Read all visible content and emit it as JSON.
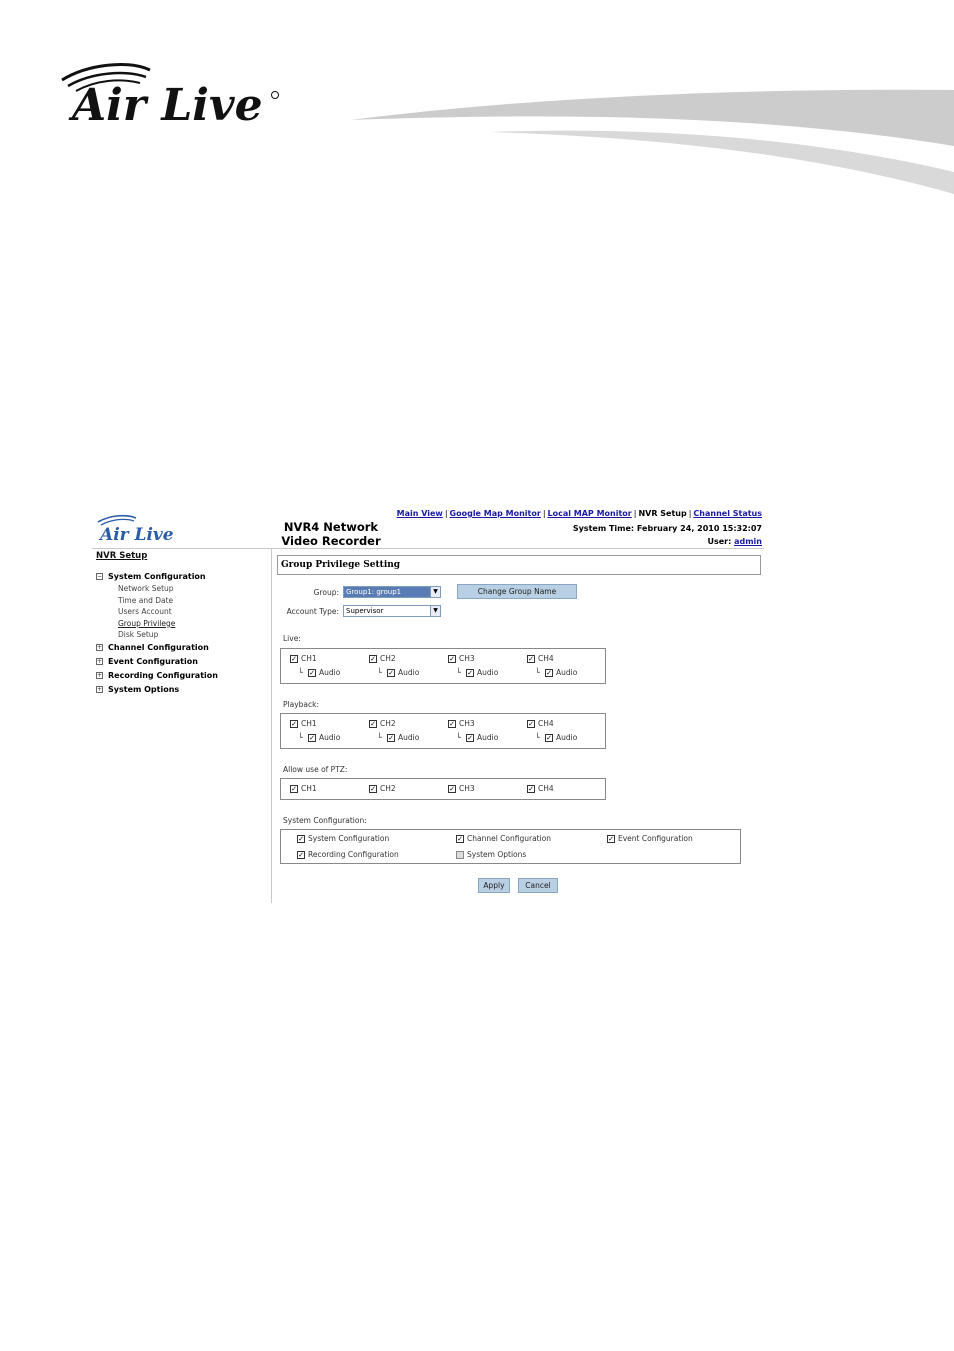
{
  "doc_header": {
    "brand": "Air Live"
  },
  "app": {
    "brand": "Air Live",
    "device_title": "NVR4 Network Video Recorder",
    "nav": [
      {
        "label": "Main View",
        "link": true
      },
      {
        "label": "Google Map Monitor",
        "link": true
      },
      {
        "label": "Local MAP Monitor",
        "link": true
      },
      {
        "label": "NVR Setup",
        "link": false
      },
      {
        "label": "Channel Status",
        "link": true
      }
    ],
    "system_time_label": "System Time:",
    "system_time_value": "February 24, 2010 15:32:07",
    "user_label": "User:",
    "user_value": "admin"
  },
  "sidebar": {
    "title": "NVR Setup",
    "system_configuration": {
      "label": "System Configuration",
      "toggle": "−",
      "items": [
        "Network Setup",
        "Time and Date",
        "Users Account",
        "Group Privilege",
        "Disk Setup"
      ],
      "active": "Group Privilege"
    },
    "collapsed": [
      {
        "label": "Channel Configuration",
        "toggle": "+"
      },
      {
        "label": "Event Configuration",
        "toggle": "+"
      },
      {
        "label": "Recording Configuration",
        "toggle": "+"
      },
      {
        "label": "System Options",
        "toggle": "+"
      }
    ]
  },
  "main": {
    "panel_title": "Group Privilege Setting",
    "group_label": "Group:",
    "group_value": "Group1: group1",
    "account_type_label": "Account Type:",
    "account_type_value": "Supervisor",
    "change_group_name": "Change Group Name",
    "live": {
      "label": "Live:",
      "channels": [
        "CH1",
        "CH2",
        "CH3",
        "CH4"
      ],
      "audio": "Audio"
    },
    "playback": {
      "label": "Playback:",
      "channels": [
        "CH1",
        "CH2",
        "CH3",
        "CH4"
      ],
      "audio": "Audio"
    },
    "ptz": {
      "label": "Allow use of PTZ:",
      "channels": [
        "CH1",
        "CH2",
        "CH3",
        "CH4"
      ]
    },
    "system_config": {
      "label": "System Configuration:",
      "items": [
        {
          "label": "System Configuration",
          "checked": true
        },
        {
          "label": "Channel Configuration",
          "checked": true
        },
        {
          "label": "Event Configuration",
          "checked": true
        },
        {
          "label": "Recording Configuration",
          "checked": true
        },
        {
          "label": "System Options",
          "checked": false
        }
      ]
    },
    "apply": "Apply",
    "cancel": "Cancel",
    "check_glyph": "✓"
  },
  "colors": {
    "link": "#1a1aa6",
    "button_bg": "#b9cfe3",
    "select_highlight": "#5a7cb4",
    "logo_dark": "#111111",
    "swoosh": "#c8c8c8"
  }
}
